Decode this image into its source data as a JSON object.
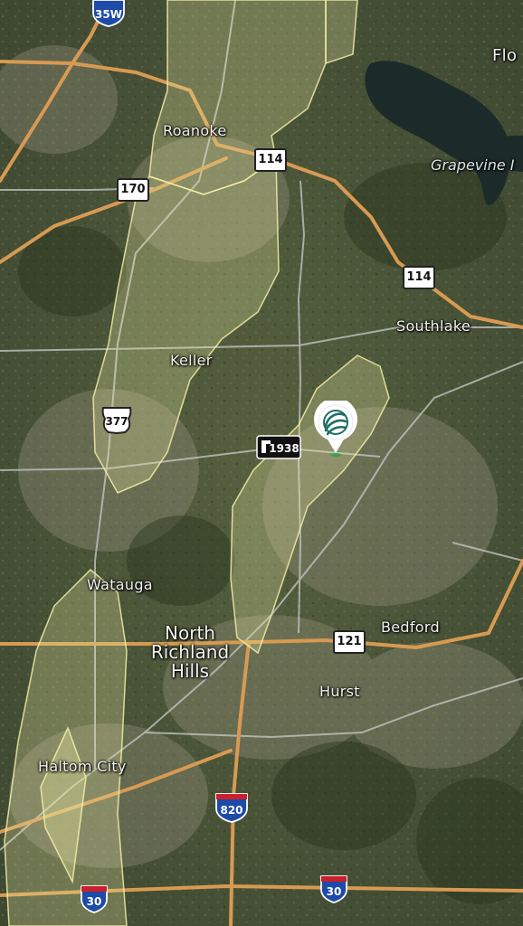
{
  "cities": {
    "roanoke": "Roanoke",
    "keller": "Keller",
    "southlake": "Southlake",
    "watauga": "Watauga",
    "north_richland_hills": "North Richland Hills",
    "north_richland_hills_lines": [
      "North",
      "Richland",
      "Hills"
    ],
    "bedford": "Bedford",
    "hurst": "Hurst",
    "haltom_city": "Haltom City",
    "flower_mound_partial": "Flo"
  },
  "water": {
    "grapevine_lake_partial": "Grapevine I"
  },
  "routes": {
    "i35w": "35W",
    "us377": "377",
    "sh114_a": "114",
    "sh114_b": "114",
    "sh170": "170",
    "fm1938": "1938",
    "sh121": "121",
    "i820": "820",
    "i30_a": "30",
    "i30_b": "30"
  },
  "colors": {
    "highway": "#d89a52",
    "road": "#c9c9c9",
    "zone_fill": "#e8eaa0",
    "zone_stroke": "#f3f0a6",
    "pin_accent": "#1f6f66"
  },
  "map_type": "satellite",
  "marker": {
    "icon": "location-marker-icon",
    "selected": true
  }
}
